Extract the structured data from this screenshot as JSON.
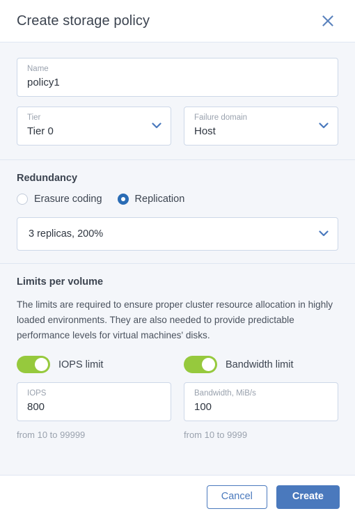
{
  "header": {
    "title": "Create storage policy",
    "close_icon": "close-icon"
  },
  "form": {
    "name": {
      "label": "Name",
      "value": "policy1"
    },
    "tier": {
      "label": "Tier",
      "value": "Tier 0",
      "chevron_icon": "chevron-down-icon"
    },
    "failure_domain": {
      "label": "Failure domain",
      "value": "Host",
      "chevron_icon": "chevron-down-icon"
    }
  },
  "redundancy": {
    "heading": "Redundancy",
    "options": [
      {
        "label": "Erasure coding",
        "selected": false
      },
      {
        "label": "Replication",
        "selected": true
      }
    ],
    "scheme": {
      "value": "3 replicas, 200%",
      "chevron_icon": "chevron-down-icon"
    }
  },
  "limits": {
    "heading": "Limits per volume",
    "description": "The limits are required to ensure proper cluster resource allocation in highly loaded environments. They are also needed to provide predictable performance levels for virtual machines' disks.",
    "iops": {
      "toggle_label": "IOPS limit",
      "toggle_on": true,
      "field_label": "IOPS",
      "value": "800",
      "hint": "from 10 to 99999"
    },
    "bandwidth": {
      "toggle_label": "Bandwidth limit",
      "toggle_on": true,
      "field_label": "Bandwidth, MiB/s",
      "value": "100",
      "hint": "from 10 to 9999"
    }
  },
  "footer": {
    "cancel_label": "Cancel",
    "create_label": "Create"
  },
  "colors": {
    "accent_blue": "#4a79bd",
    "radio_blue": "#2a6cb5",
    "toggle_green": "#96c93d",
    "background": "#f4f6fa",
    "divider": "#dfe6f2",
    "field_border": "#cdd8e8"
  }
}
